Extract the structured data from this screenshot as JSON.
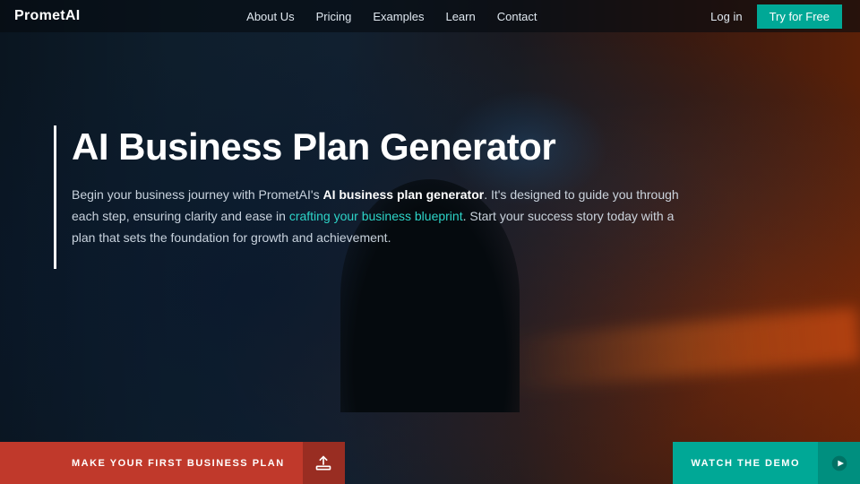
{
  "brand": {
    "logo": "PrometAI"
  },
  "nav": {
    "links": [
      {
        "label": "About Us",
        "id": "about"
      },
      {
        "label": "Pricing",
        "id": "pricing"
      },
      {
        "label": "Examples",
        "id": "examples"
      },
      {
        "label": "Learn",
        "id": "learn"
      },
      {
        "label": "Contact",
        "id": "contact"
      }
    ],
    "login_label": "Log in",
    "try_label": "Try for Free"
  },
  "hero": {
    "title": "AI Business Plan Generator",
    "description_part1": "Begin your business journey with PrometAI's ",
    "description_bold": "AI business plan generator",
    "description_part2": ". It's designed to guide you through each step, ensuring clarity and ease in ",
    "description_link": "crafting your business blueprint",
    "description_part3": ". Start your success story today with a plan that sets the foundation for growth and achievement."
  },
  "cta": {
    "left_label": "MAKE YOUR FIRST BUSINESS PLAN",
    "right_label": "WATCH THE DEMO"
  },
  "colors": {
    "red": "#c0392b",
    "teal": "#00a896",
    "link": "#2dd4c8"
  }
}
